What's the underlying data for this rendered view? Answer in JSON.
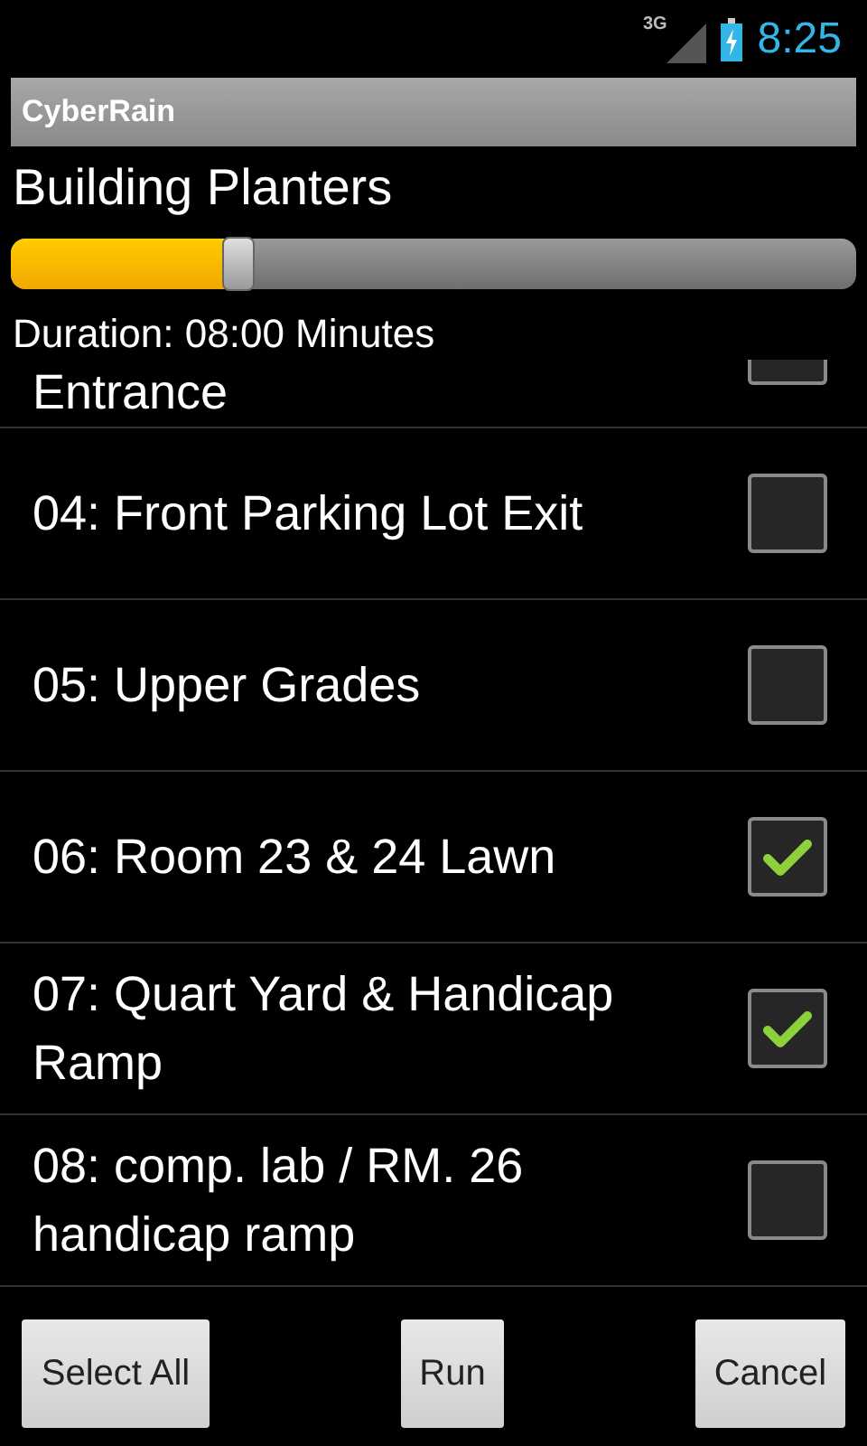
{
  "status_bar": {
    "network": "3G",
    "time": "8:25"
  },
  "window": {
    "title": "CyberRain"
  },
  "program": {
    "name": "Building Planters",
    "duration": {
      "level": 0.27
    },
    "duration_text": "Duration: 08:00 Minutes"
  },
  "zones": [
    {
      "label": "Entrance",
      "checked": false
    },
    {
      "label": "04: Front Parking Lot Exit",
      "checked": false
    },
    {
      "label": "05: Upper Grades",
      "checked": false
    },
    {
      "label": "06: Room 23 & 24 Lawn",
      "checked": true
    },
    {
      "label": "07: Quart Yard & Handicap Ramp",
      "checked": true
    },
    {
      "label": "08: comp. lab / RM. 26 handicap ramp",
      "checked": false
    }
  ],
  "buttons": [
    "Select All",
    "Run",
    "Cancel"
  ]
}
